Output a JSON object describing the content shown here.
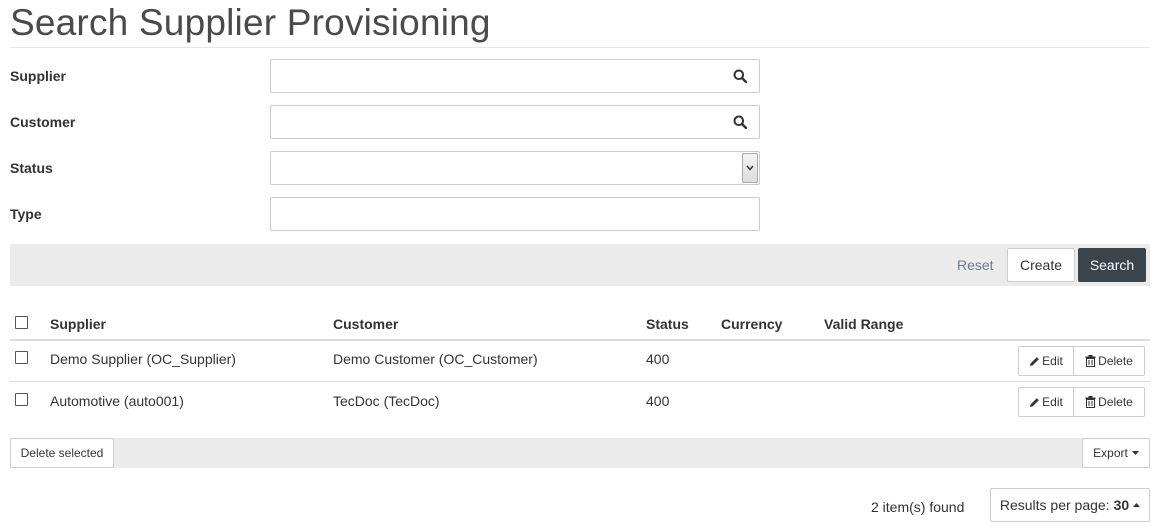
{
  "page": {
    "title": "Search Supplier Provisioning"
  },
  "form": {
    "supplier": {
      "label": "Supplier",
      "value": ""
    },
    "customer": {
      "label": "Customer",
      "value": ""
    },
    "status": {
      "label": "Status",
      "selected": ""
    },
    "type": {
      "label": "Type",
      "value": ""
    }
  },
  "actions": {
    "reset": "Reset",
    "create": "Create",
    "search": "Search"
  },
  "table": {
    "columns": [
      "Supplier",
      "Customer",
      "Status",
      "Currency",
      "Valid Range"
    ],
    "rows": [
      {
        "supplier": "Demo Supplier (OC_Supplier)",
        "customer": "Demo Customer (OC_Customer)",
        "status": "400",
        "currency": "",
        "valid_range": "",
        "edit": "Edit",
        "delete": "Delete"
      },
      {
        "supplier": "Automotive (auto001)",
        "customer": "TecDoc (TecDoc)",
        "status": "400",
        "currency": "",
        "valid_range": "",
        "edit": "Edit",
        "delete": "Delete"
      }
    ]
  },
  "footer": {
    "delete_selected": "Delete selected",
    "export": "Export",
    "items_found": "2 item(s) found",
    "results_per_page_label": "Results per page:",
    "results_per_page_value": "30"
  },
  "icons": {
    "search": "search-icon",
    "edit": "pencil-icon",
    "delete": "trash-icon",
    "caret_down": "caret-down-icon",
    "caret_up": "caret-up-icon"
  },
  "colors": {
    "primary_button": "#3b434b",
    "toolbar_bg": "#ebebeb",
    "reset_link": "#6a7d8c"
  }
}
